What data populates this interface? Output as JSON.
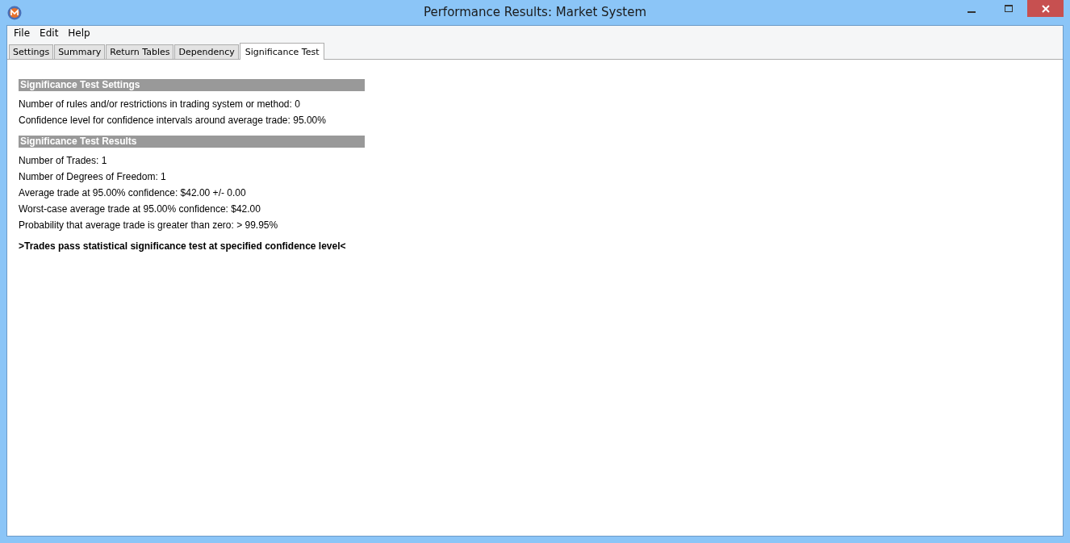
{
  "window": {
    "title": "Performance Results: Market System"
  },
  "menu": [
    "File",
    "Edit",
    "Help"
  ],
  "tabs": [
    {
      "label": "Settings",
      "selected": false
    },
    {
      "label": "Summary",
      "selected": false
    },
    {
      "label": "Return Tables",
      "selected": false
    },
    {
      "label": "Dependency",
      "selected": false
    },
    {
      "label": "Significance Test",
      "selected": true
    }
  ],
  "sections": [
    {
      "heading": "Significance Test Settings",
      "lines": [
        "Number of rules and/or restrictions in trading system or method: 0",
        "Confidence level for confidence intervals around average trade: 95.00%"
      ]
    },
    {
      "heading": "Significance Test Results",
      "lines": [
        "Number of Trades: 1",
        "Number of Degrees of Freedom: 1",
        "Average trade at 95.00% confidence: $42.00 +/- 0.00",
        "Worst-case average trade at 95.00% confidence: $42.00",
        "Probability that average trade is greater than zero: > 99.95%"
      ]
    }
  ],
  "verdict": ">Trades pass statistical significance test at specified confidence level<"
}
